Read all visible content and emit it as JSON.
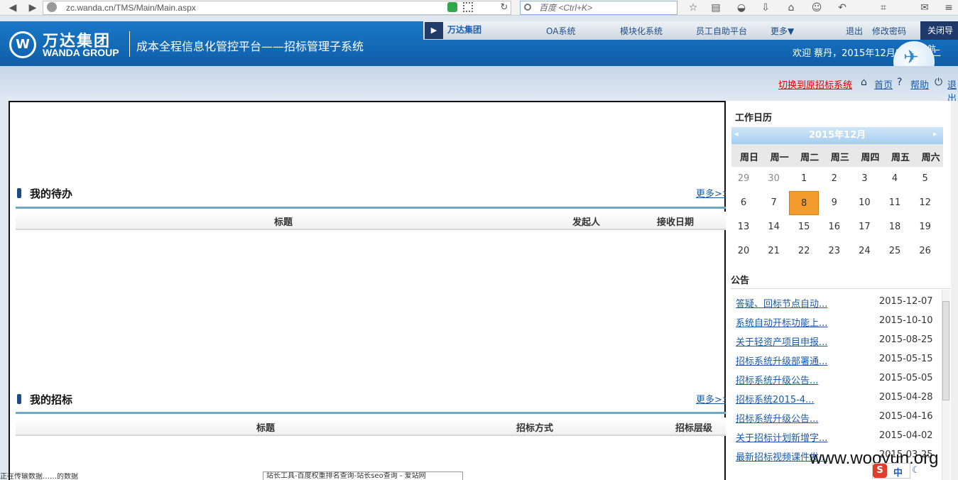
{
  "browser": {
    "url": "zc.wanda.cn/TMS/Main/Main.aspx",
    "search_placeholder": "百度 <Ctrl+K>"
  },
  "header": {
    "logo_text": "万达集团",
    "logo_sub": "WANDA GROUP",
    "system_title": "成本全程信息化管控平台——招标管理子系统",
    "nav_logo": "万达集团",
    "nav_items": [
      "OA系统",
      "模块化系统",
      "员工自助平台",
      "更多▼",
      "退出",
      "修改密码"
    ],
    "close_nav": "关闭导航",
    "welcome": "欢迎 蔡丹，2015年12月8日 星期二"
  },
  "subbar": {
    "switch_link": "切换到原招标系统",
    "home_link": "首页",
    "help_link": "帮助",
    "exit_link": "退出"
  },
  "todo": {
    "title": "我的待办",
    "more": "更多>>",
    "col_title": "标题",
    "col_sender": "发起人",
    "col_date": "接收日期"
  },
  "bids": {
    "title": "我的招标",
    "more": "更多>>",
    "col_title": "标题",
    "col_method": "招标方式",
    "col_level": "招标层级"
  },
  "calendar": {
    "label": "工作日历",
    "month": "2015年12月",
    "weekdays": [
      "周日",
      "周一",
      "周二",
      "周三",
      "周四",
      "周五",
      "周六"
    ],
    "days": [
      "29",
      "30",
      "1",
      "2",
      "3",
      "4",
      "5",
      "6",
      "7",
      "8",
      "9",
      "10",
      "11",
      "12",
      "13",
      "14",
      "15",
      "16",
      "17",
      "18",
      "19",
      "20",
      "21",
      "22",
      "23",
      "24",
      "25",
      "26"
    ]
  },
  "notices": {
    "label": "公告",
    "items": [
      {
        "title": "答疑、回标节点自动...",
        "date": "2015-12-07"
      },
      {
        "title": "系统自动开标功能上...",
        "date": "2015-10-10"
      },
      {
        "title": "关于轻资产项目申报...",
        "date": "2015-08-25"
      },
      {
        "title": "招标系统升级部署通...",
        "date": "2015-05-15"
      },
      {
        "title": "招标系统升级公告...",
        "date": "2015-05-05"
      },
      {
        "title": "招标系统2015-4...",
        "date": "2015-04-28"
      },
      {
        "title": "招标系统升级公告...",
        "date": "2015-04-16"
      },
      {
        "title": "关于招标计划新增字...",
        "date": "2015-04-02"
      },
      {
        "title": "最新招标视频课件发...",
        "date": "2015-03-25"
      }
    ]
  },
  "status_text": "正在传输数据……的数据",
  "tooltip": "站长工具-百度权重排名查询-站长seo查询 - 爱站网",
  "watermark": "www.wooyun.org",
  "ime": {
    "logo": "S",
    "mode": "中"
  }
}
